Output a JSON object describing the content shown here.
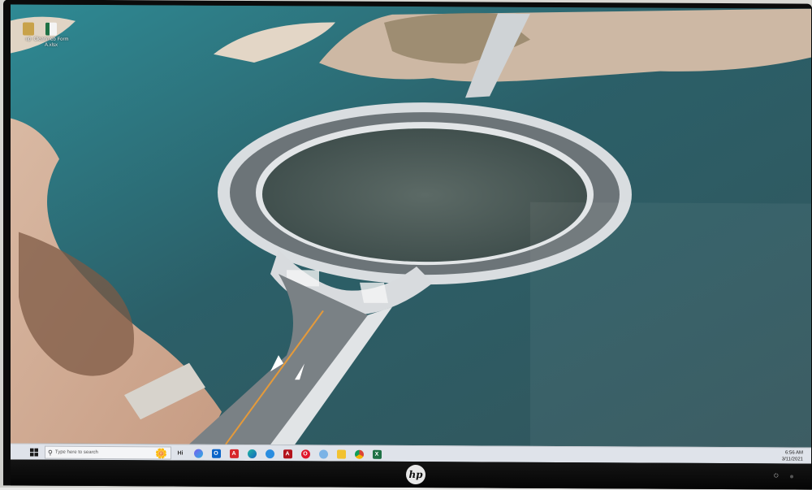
{
  "desktop": {
    "icons": [
      {
        "label": "up",
        "icon": "user-folder-icon"
      },
      {
        "label": "Cleanmeb Form A.xlsx",
        "icon": "excel-file-icon"
      }
    ]
  },
  "taskbar": {
    "start_icon": "windows-start-icon",
    "search_placeholder": "Type here to search",
    "pinned": [
      {
        "name": "hi-text",
        "label": "Hi"
      },
      {
        "name": "copilot-icon",
        "label": ""
      },
      {
        "name": "outlook-icon",
        "label": "O"
      },
      {
        "name": "acrobat-icon",
        "label": "A"
      },
      {
        "name": "edge-icon",
        "label": ""
      },
      {
        "name": "media-icon",
        "label": ""
      },
      {
        "name": "acrobat-reader-icon",
        "label": "A"
      },
      {
        "name": "opera-icon",
        "label": "O"
      },
      {
        "name": "snipping-tool-icon",
        "label": ""
      },
      {
        "name": "file-explorer-icon",
        "label": ""
      },
      {
        "name": "chrome-icon",
        "label": ""
      },
      {
        "name": "excel-icon",
        "label": "X"
      }
    ],
    "time": "6:56 AM",
    "date": "3/11/2021"
  },
  "monitor": {
    "brand": "hp"
  },
  "colors": {
    "water": "#2e6a73",
    "taskbar": "#dfe3ea",
    "bezel": "#0b0b0b"
  }
}
